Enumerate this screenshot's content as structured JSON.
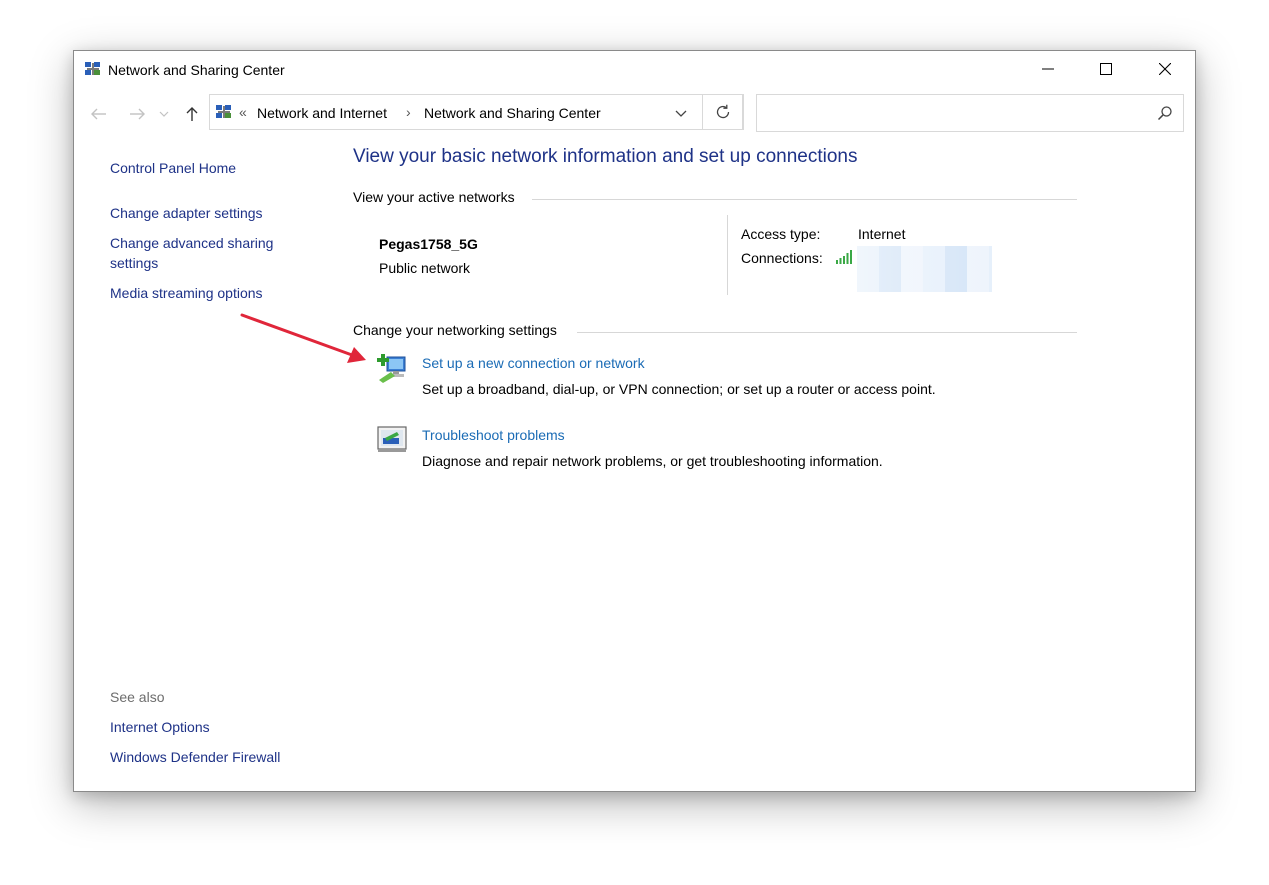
{
  "window": {
    "title": "Network and Sharing Center"
  },
  "address_bar": {
    "crumb_overflow": "«",
    "crumbs": [
      "Network and Internet",
      "Network and Sharing Center"
    ],
    "separator": "›"
  },
  "search": {
    "value": "",
    "placeholder": ""
  },
  "left_pane": {
    "home": "Control Panel Home",
    "links": [
      "Change adapter settings",
      "Change advanced sharing settings",
      "Media streaming options"
    ],
    "see_also_heading": "See also",
    "see_also": [
      "Internet Options",
      "Windows Defender Firewall"
    ]
  },
  "main": {
    "title": "View your basic network information and set up connections",
    "active_networks_heading": "View your active networks",
    "network": {
      "name": "Pegas1758_5G",
      "category": "Public network",
      "access_type_label": "Access type:",
      "access_type_value": "Internet",
      "connections_label": "Connections:"
    },
    "change_settings_heading": "Change your networking settings",
    "tasks": [
      {
        "link": "Set up a new connection or network",
        "description": "Set up a broadband, dial-up, or VPN connection; or set up a router or access point.",
        "icon": "new-connection-icon"
      },
      {
        "link": "Troubleshoot problems",
        "description": "Diagnose and repair network problems, or get troubleshooting information.",
        "icon": "troubleshoot-icon"
      }
    ]
  },
  "colors": {
    "link": "#1e3287",
    "task_link": "#1a6bb5",
    "annotation_arrow": "#e0263a"
  }
}
